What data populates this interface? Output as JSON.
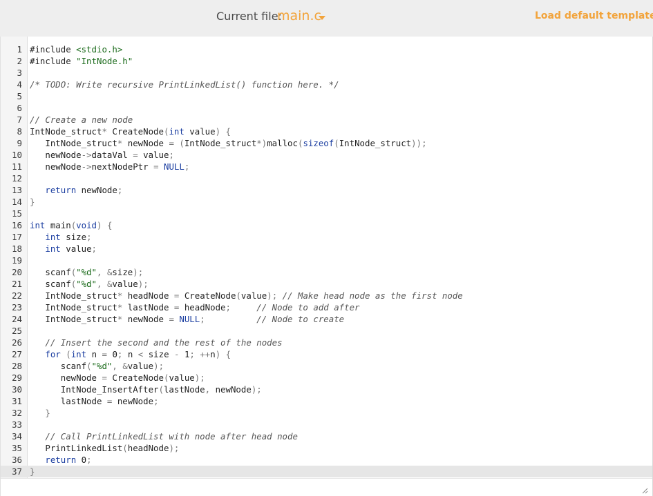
{
  "header": {
    "current_file_label": "Current file:",
    "current_file_name": "main.c",
    "load_template_label": "Load default template..."
  },
  "editor": {
    "active_line": 37,
    "lines": [
      "#include <stdio.h>",
      "#include \"IntNode.h\"",
      "",
      "/* TODO: Write recursive PrintLinkedList() function here. */",
      "",
      "",
      "// Create a new node",
      "IntNode_struct* CreateNode(int value) {",
      "   IntNode_struct* newNode = (IntNode_struct*)malloc(sizeof(IntNode_struct));",
      "   newNode->dataVal = value;",
      "   newNode->nextNodePtr = NULL;",
      "",
      "   return newNode;",
      "}",
      "",
      "int main(void) {",
      "   int size;",
      "   int value;",
      "",
      "   scanf(\"%d\", &size);",
      "   scanf(\"%d\", &value);",
      "   IntNode_struct* headNode = CreateNode(value); // Make head node as the first node",
      "   IntNode_struct* lastNode = headNode;     // Node to add after",
      "   IntNode_struct* newNode = NULL;          // Node to create",
      "",
      "   // Insert the second and the rest of the nodes",
      "   for (int n = 0; n < size - 1; ++n) {",
      "      scanf(\"%d\", &value);",
      "      newNode = CreateNode(value);",
      "      IntNode_InsertAfter(lastNode, newNode);",
      "      lastNode = newNode;",
      "   }",
      "",
      "   // Call PrintLinkedList with node after head node",
      "   PrintLinkedList(headNode);",
      "   return 0;",
      "}"
    ]
  }
}
